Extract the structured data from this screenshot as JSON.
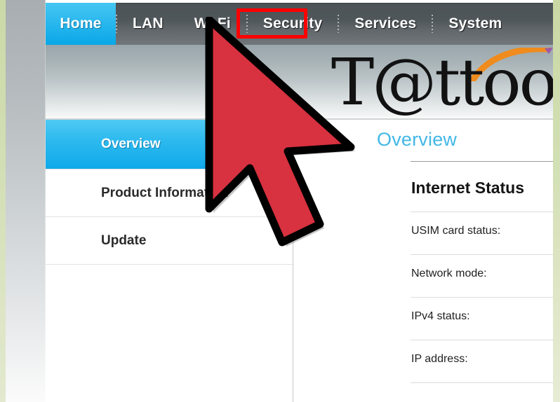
{
  "navbar": {
    "items": [
      {
        "label": "Home",
        "active": true,
        "name": "nav-tab-home"
      },
      {
        "label": "LAN",
        "active": false,
        "name": "nav-tab-lan"
      },
      {
        "label": "Wi-Fi",
        "active": false,
        "name": "nav-tab-wifi"
      },
      {
        "label": "Security",
        "active": false,
        "name": "nav-tab-security"
      },
      {
        "label": "Services",
        "active": false,
        "name": "nav-tab-services"
      },
      {
        "label": "System",
        "active": false,
        "name": "nav-tab-system"
      }
    ],
    "active_background": "#0aa7e8",
    "background": "#50575b",
    "highlight_color": "#fe0000"
  },
  "banner": {
    "brand": "T@ttoo",
    "swoosh_color": "#f08b1d"
  },
  "sidebar": {
    "items": [
      {
        "label": "Overview",
        "active": true
      },
      {
        "label": "Product Information",
        "active": false
      },
      {
        "label": "Update",
        "active": false
      }
    ],
    "active_color": "#10a9e9"
  },
  "content": {
    "title": "Overview",
    "title_color": "#43b8e6",
    "section_title": "Internet Status",
    "rows": [
      {
        "label": "USIM card status:",
        "value": ""
      },
      {
        "label": "Network mode:",
        "value": ""
      },
      {
        "label": "IPv4 status:",
        "value": ""
      },
      {
        "label": "IP address:",
        "value": ""
      }
    ]
  },
  "cursor": {
    "icon": "mouse-pointer-arrow",
    "fill": "#d8313f",
    "stroke": "#000000"
  }
}
